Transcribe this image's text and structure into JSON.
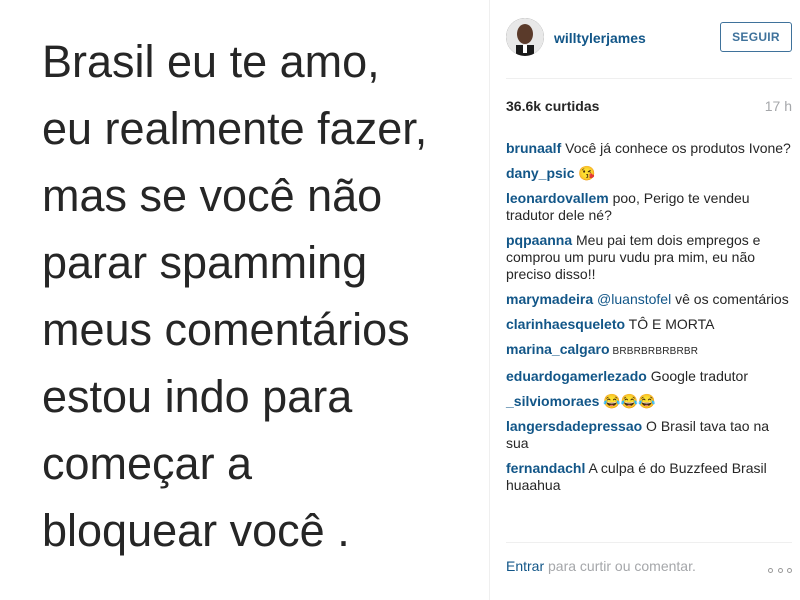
{
  "post": {
    "image_text_lines": [
      "Brasil eu te amo,",
      "eu realmente fazer,",
      "mas se você não",
      "parar spamming",
      "meus comentários",
      "estou indo para",
      "começar a",
      "bloquear você ."
    ]
  },
  "header": {
    "username": "willtylerjames",
    "follow_label": "SEGUIR"
  },
  "stats": {
    "likes": "36.6k curtidas",
    "time": "17 h"
  },
  "comments": [
    {
      "user": "brunaalf",
      "text": " Você já conhece os produtos Ivone?"
    },
    {
      "user": "dany_psic",
      "text": " 😘"
    },
    {
      "user": "leonardovallem",
      "text": " poo, Perigo te vendeu tradutor dele né?"
    },
    {
      "user": "pqpaanna",
      "text": " Meu pai tem dois empregos e comprou um puru vudu pra mim, eu não preciso disso!!"
    },
    {
      "user": "marymadeira",
      "mention": " @luanstofel",
      "text": " vê os comentários"
    },
    {
      "user": "clarinhaesqueleto",
      "text": " TÔ E MORTA"
    },
    {
      "user": "marina_calgaro",
      "text": " BRBRBRBRBRBR"
    },
    {
      "user": "eduardogamerlezado",
      "text": " Google tradutor"
    },
    {
      "user": "_silviomoraes",
      "text": " 😂😂😂"
    },
    {
      "user": "langersdadepressao",
      "text": " O Brasil tava tao na sua"
    },
    {
      "user": "fernandachl",
      "text": " A culpa é do Buzzfeed Brasil huaahua"
    }
  ],
  "footer": {
    "enter_label": "Entrar",
    "rest_label": " para curtir ou comentar."
  },
  "icons": {
    "more": "more-options-icon"
  },
  "colors": {
    "link_blue": "#125688",
    "follow_blue": "#3f729b",
    "muted": "#a5a7aa"
  }
}
